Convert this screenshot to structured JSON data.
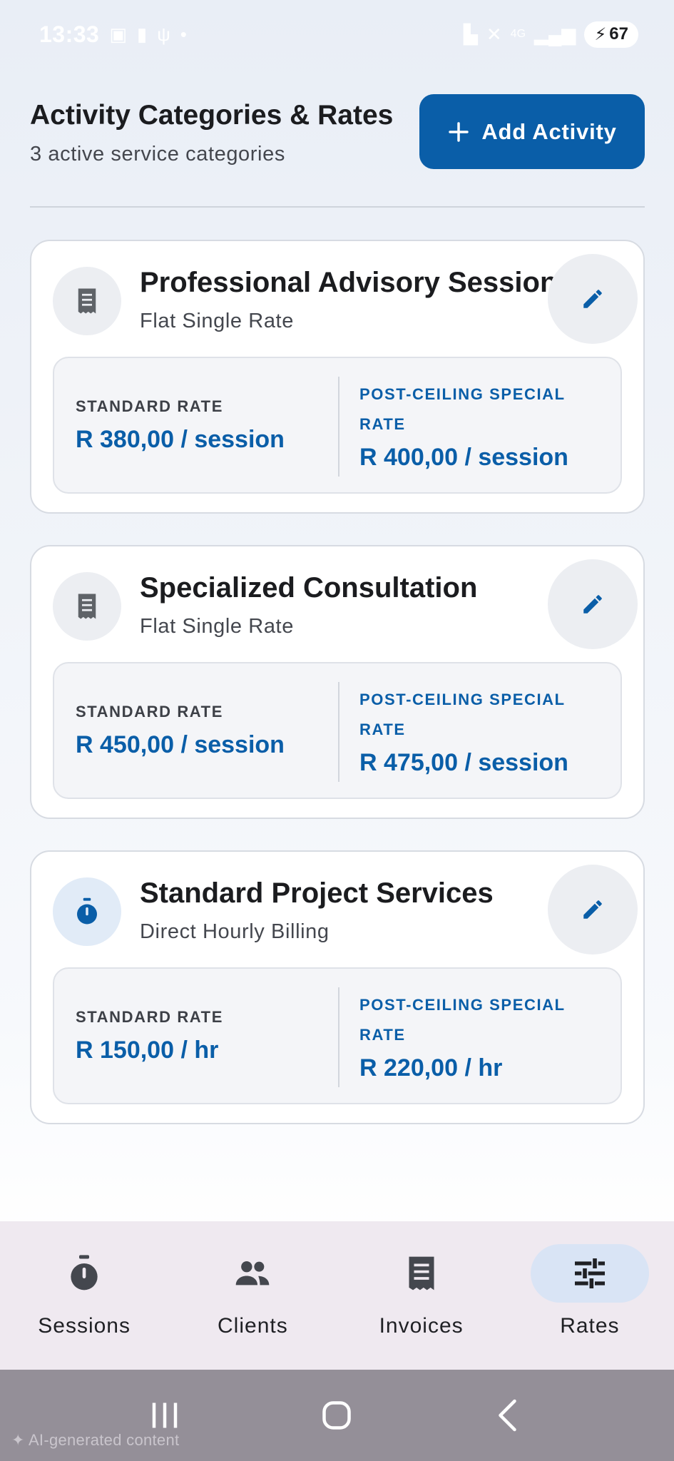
{
  "status_bar": {
    "time": "13:33",
    "battery": "67",
    "network": "4G"
  },
  "header": {
    "title": "Activity Categories & Rates",
    "subtitle": "3 active service categories",
    "add_button_label": "Add Activity"
  },
  "activities": [
    {
      "title": "Professional Advisory Session",
      "billing_type": "Flat Single Rate",
      "icon": "receipt-icon",
      "standard_label": "STANDARD RATE",
      "standard_rate": "R 380,00 / session",
      "special_label_line1": "POST-CEILING SPECIAL",
      "special_label_line2": "RATE",
      "special_rate": "R 400,00 / session"
    },
    {
      "title": "Specialized Consultation",
      "billing_type": "Flat Single Rate",
      "icon": "receipt-icon",
      "standard_label": "STANDARD RATE",
      "standard_rate": "R 450,00 / session",
      "special_label_line1": "POST-CEILING SPECIAL",
      "special_label_line2": "RATE",
      "special_rate": "R 475,00 / session"
    },
    {
      "title": "Standard Project Services",
      "billing_type": "Direct Hourly Billing",
      "icon": "stopwatch-icon",
      "standard_label": "STANDARD RATE",
      "standard_rate": "R 150,00 / hr",
      "special_label_line1": "POST-CEILING SPECIAL",
      "special_label_line2": "RATE",
      "special_rate": "R 220,00 / hr"
    }
  ],
  "bottom_nav": {
    "items": [
      {
        "label": "Sessions",
        "icon": "stopwatch-icon",
        "active": false
      },
      {
        "label": "Clients",
        "icon": "people-icon",
        "active": false
      },
      {
        "label": "Invoices",
        "icon": "receipt-icon",
        "active": false
      },
      {
        "label": "Rates",
        "icon": "sliders-icon",
        "active": true
      }
    ]
  },
  "footer_note": "AI-generated content",
  "colors": {
    "primary": "#0a5ea8",
    "card_border": "#d7dbe2",
    "nav_background": "#efe9f0",
    "active_pill": "#d9e4f5"
  }
}
